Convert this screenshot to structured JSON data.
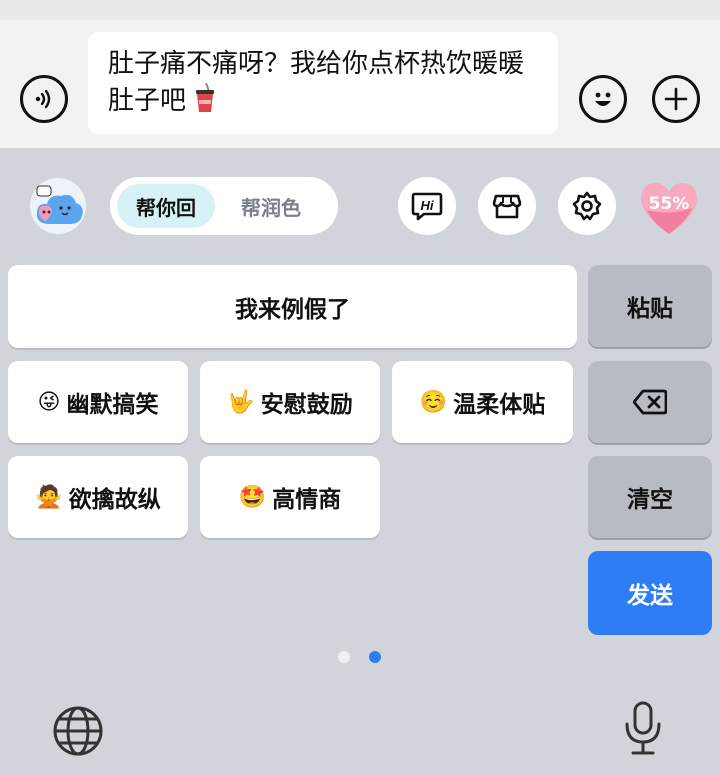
{
  "input": {
    "text": "肚子痛不痛呀？我给你点杯热饮暖暖肚子吧"
  },
  "top_bar": {
    "voice_icon": "voice-wave-icon",
    "emoji_icon": "smiley-icon",
    "add_icon": "plus-icon"
  },
  "assistant": {
    "tabs": [
      {
        "label": "帮你回",
        "active": true
      },
      {
        "label": "帮润色",
        "active": false
      }
    ],
    "tools": [
      "hi-chat-icon",
      "store-icon",
      "settings-gear-icon"
    ],
    "affinity": "55%"
  },
  "suggestions": {
    "primary": "我来例假了",
    "styles": [
      {
        "emoji": "😜",
        "label": "幽默搞笑"
      },
      {
        "emoji": "🤟",
        "label": "安慰鼓励"
      },
      {
        "emoji": "☺️",
        "label": "温柔体贴"
      },
      {
        "emoji": "🙅",
        "label": "欲擒故纵"
      },
      {
        "emoji": "🤩",
        "label": "高情商"
      }
    ]
  },
  "keys": {
    "paste": "粘贴",
    "clear": "清空",
    "send": "发送"
  },
  "pager": {
    "pages": 2,
    "current": 2
  },
  "colors": {
    "accent": "#2f7df6",
    "keyboard_bg": "#d1d5db",
    "active_tab_bg": "#d7f2f6"
  }
}
